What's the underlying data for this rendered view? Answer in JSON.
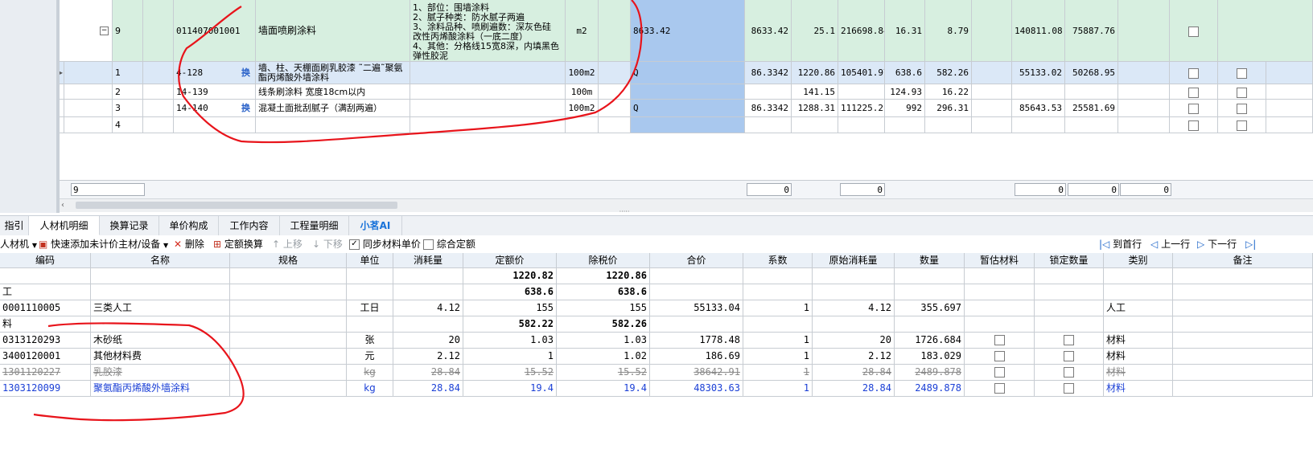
{
  "top": {
    "main_row": {
      "seq": "9",
      "code": "011407001001",
      "name": "墙面喷刷涂料",
      "feature_lines": [
        "1、部位：围墙涂料",
        "2、腻子种类：防水腻子两遍",
        "3、涂料品种、喷刷遍数：深灰色硅",
        "改性丙烯酸涂料（一底二度）",
        "4、其他：分格线15宽8深，内填黑色",
        "弹性胶泥"
      ],
      "unit": "m2",
      "qty_expr": "8633.42",
      "qty": "8633.42",
      "unit_price": "25.1",
      "total": "216698.84",
      "labor": "16.31",
      "material": "8.79",
      "labor_total": "140811.08",
      "material_total": "75887.76"
    },
    "sub_rows": [
      {
        "seq": "1",
        "code": "4-128",
        "swap": "换",
        "name": "墙、柱、天棚面刷乳胶漆 ˜二遍˜聚氨酯丙烯酸外墙涂料",
        "unit": "100m2",
        "expr": "Q",
        "qty": "86.3342",
        "unit_price": "1220.86",
        "total": "105401.97",
        "labor": "638.6",
        "material": "582.26",
        "labor_total": "55133.02",
        "material_total": "50268.95"
      },
      {
        "seq": "2",
        "code": "14-139",
        "swap": "",
        "name": "线条刷涂料 宽度18cm以内",
        "unit": "100m",
        "expr": "",
        "qty": "",
        "unit_price": "141.15",
        "total": "",
        "labor": "124.93",
        "material": "16.22",
        "labor_total": "",
        "material_total": ""
      },
      {
        "seq": "3",
        "code": "14-140",
        "swap": "换",
        "name": "混凝土面批刮腻子（满刮两遍）",
        "unit": "100m2",
        "expr": "Q",
        "qty": "86.3342",
        "unit_price": "1288.31",
        "total": "111225.21",
        "labor": "992",
        "material": "296.31",
        "labor_total": "85643.53",
        "material_total": "25581.69"
      },
      {
        "seq": "4",
        "code": "",
        "swap": "",
        "name": "",
        "unit": "",
        "expr": "",
        "qty": "",
        "unit_price": "",
        "total": "",
        "labor": "",
        "material": "",
        "labor_total": "",
        "material_total": ""
      }
    ],
    "footer": {
      "count": "9",
      "v1": "0",
      "v2": "0",
      "v3": "0",
      "v4": "0",
      "v5": "0"
    }
  },
  "tabs": [
    "指引",
    "人材机明细",
    "换算记录",
    "单价构成",
    "工作内容",
    "工程量明细",
    "小茗AI"
  ],
  "toolbar": {
    "rcj": "人材机",
    "quick_add": "快速添加未计价主材/设备",
    "delete": "删除",
    "quota_convert": "定额换算",
    "move_up": "上移",
    "move_down": "下移",
    "sync_price": "同步材料单价",
    "combined_quota": "综合定额",
    "first_row": "到首行",
    "prev_row": "上一行",
    "next_row": "下一行"
  },
  "detail_headers": [
    "编码",
    "名称",
    "规格",
    "单位",
    "消耗量",
    "定额价",
    "除税价",
    "合价",
    "系数",
    "原始消耗量",
    "数量",
    "暂估材料",
    "锁定数量",
    "类别",
    "备注"
  ],
  "detail_rows": [
    {
      "code": "",
      "name": "",
      "unit": "",
      "usage": "",
      "quota_price": "1220.82",
      "tax_ex": "1220.86",
      "total": "",
      "coef": "",
      "orig": "",
      "qty": "",
      "cat": "",
      "style": "bold",
      "checks": false
    },
    {
      "code": "工",
      "name": "",
      "unit": "",
      "usage": "",
      "quota_price": "638.6",
      "tax_ex": "638.6",
      "total": "",
      "coef": "",
      "orig": "",
      "qty": "",
      "cat": "",
      "style": "bold",
      "checks": false
    },
    {
      "code": "0001110005",
      "name": "三类人工",
      "unit": "工日",
      "usage": "4.12",
      "quota_price": "155",
      "tax_ex": "155",
      "total": "55133.04",
      "coef": "1",
      "orig": "4.12",
      "qty": "355.697",
      "cat": "人工",
      "style": "normal",
      "checks": false
    },
    {
      "code": "料",
      "name": "",
      "unit": "",
      "usage": "",
      "quota_price": "582.22",
      "tax_ex": "582.26",
      "total": "",
      "coef": "",
      "orig": "",
      "qty": "",
      "cat": "",
      "style": "bold",
      "checks": false
    },
    {
      "code": "0313120293",
      "name": "木砂纸",
      "unit": "张",
      "usage": "20",
      "quota_price": "1.03",
      "tax_ex": "1.03",
      "total": "1778.48",
      "coef": "1",
      "orig": "20",
      "qty": "1726.684",
      "cat": "材料",
      "style": "normal",
      "checks": true
    },
    {
      "code": "3400120001",
      "name": "其他材料费",
      "unit": "元",
      "usage": "2.12",
      "quota_price": "1",
      "tax_ex": "1.02",
      "total": "186.69",
      "coef": "1",
      "orig": "2.12",
      "qty": "183.029",
      "cat": "材料",
      "style": "normal",
      "checks": true
    },
    {
      "code": "1301120227",
      "name": "乳胶漆",
      "unit": "kg",
      "usage": "28.84",
      "quota_price": "15.52",
      "tax_ex": "15.52",
      "total": "38642.91",
      "coef": "1",
      "orig": "28.84",
      "qty": "2489.878",
      "cat": "材料",
      "style": "strike",
      "checks": true
    },
    {
      "code": "1303120099",
      "name": "聚氨酯丙烯酸外墙涂料",
      "unit": "kg",
      "usage": "28.84",
      "quota_price": "19.4",
      "tax_ex": "19.4",
      "total": "48303.63",
      "coef": "1",
      "orig": "28.84",
      "qty": "2489.878",
      "cat": "材料",
      "style": "blue",
      "checks": true
    }
  ],
  "colors": {
    "green_row": "#d7efe0",
    "selected_cell": "#a9c8ee",
    "annotation": "#e8141b",
    "link_blue": "#1a3fd6"
  }
}
